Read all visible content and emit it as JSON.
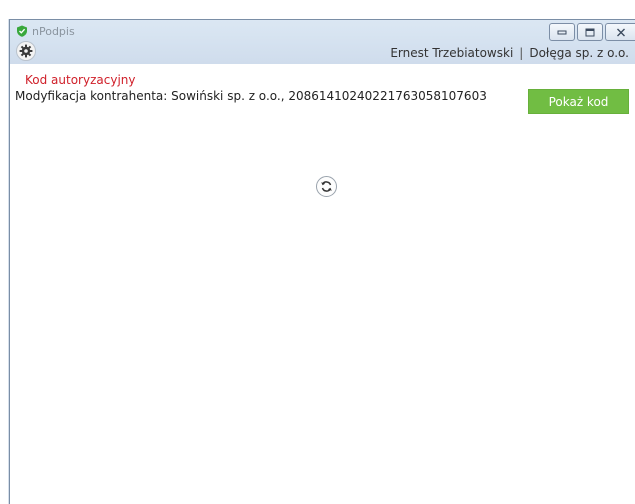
{
  "window": {
    "title": "nPodpis",
    "minimize_icon": "minimize-icon",
    "maximize_icon": "maximize-icon",
    "close_icon": "close-icon"
  },
  "header": {
    "settings_icon": "gear-icon",
    "user_name": "Ernest Trzebiatowski",
    "separator": "|",
    "company": "Dołęga sp. z o.o."
  },
  "auth": {
    "section_title": "Kod autoryzacyjny",
    "request_text": "Modyfikacja kontrahenta: Sowiński sp. z o.o., 20861410240221763058107603",
    "show_code_label": "Pokaż kod"
  },
  "refresh": {
    "icon": "refresh-icon"
  },
  "colors": {
    "accent_red": "#d0202a",
    "button_green": "#71bd43",
    "app_icon_green": "#39a83c"
  }
}
